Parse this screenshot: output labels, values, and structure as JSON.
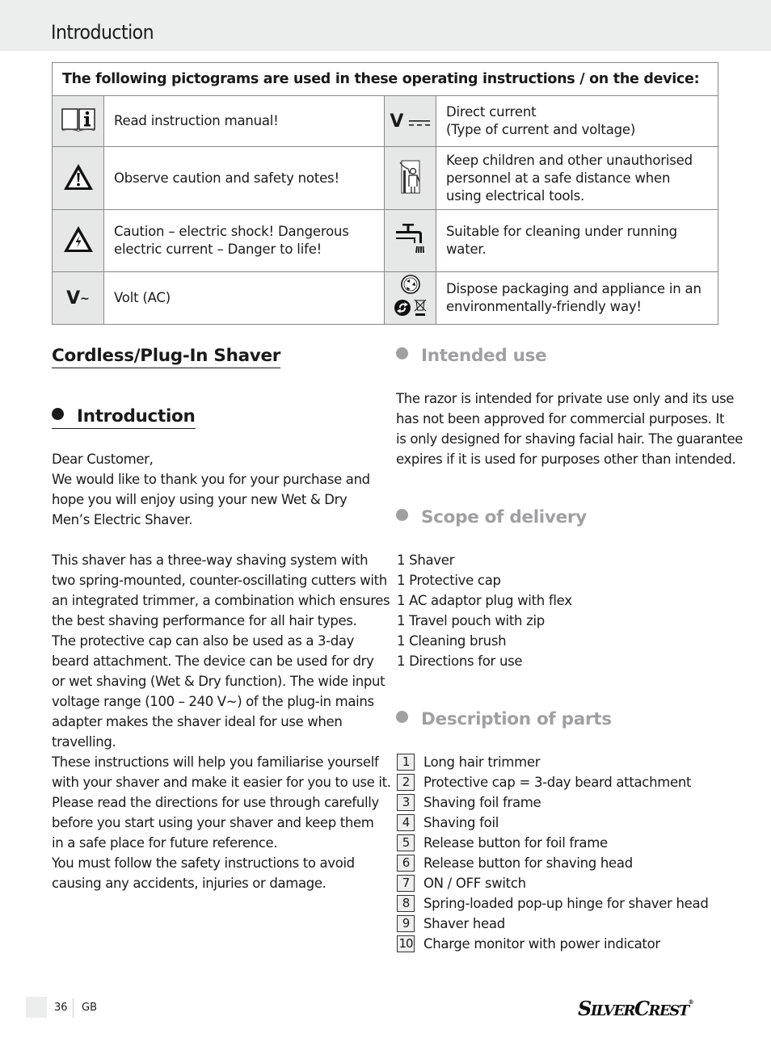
{
  "header": {
    "title": "Introduction"
  },
  "pictogram_table": {
    "heading": "The following pictograms are used in these operating instructions / on the device:",
    "rows": [
      {
        "left": {
          "icon": "book-info-icon",
          "text": "Read instruction manual!"
        },
        "right": {
          "icon": "direct-current-icon",
          "icon_label": "V",
          "text_line1": "Direct current",
          "text_line2": "(Type of current and voltage)"
        }
      },
      {
        "left": {
          "icon": "warning-triangle-icon",
          "text": "Observe caution and safety notes!"
        },
        "right": {
          "icon": "keep-children-away-icon",
          "text": "Keep children and other unauthorised personnel at a safe distance when using electrical tools."
        }
      },
      {
        "left": {
          "icon": "electric-shock-icon",
          "text": "Caution – electric shock! Dangerous electric current – Danger to life!"
        },
        "right": {
          "icon": "running-water-tap-icon",
          "text": "Suitable for cleaning under running water."
        }
      },
      {
        "left": {
          "icon": "volt-ac-icon",
          "icon_label": "V",
          "icon_suffix": "~",
          "text": "Volt (AC)"
        },
        "right": {
          "icon": "recycling-disposal-icon",
          "text": "Dispose packaging and appliance in an environmentally-friendly way!"
        }
      }
    ]
  },
  "left_column": {
    "product_title": "Cordless/Plug-In Shaver",
    "intro_heading": "Introduction",
    "paragraphs": [
      [
        "Dear Customer,",
        "We would like to thank you for your purchase and",
        "hope you will enjoy using your new Wet & Dry",
        "Men’s Electric Shaver."
      ],
      [
        "This shaver has a three-way shaving system with",
        "two spring-mounted, counter-oscillating cutters with",
        "an integrated trimmer, a combination which ensures",
        "the best shaving performance for all hair types.",
        "The protective cap can also be used as a 3-day",
        "beard attachment. The device can be used for dry",
        "or wet shaving (Wet & Dry function). The wide input",
        "voltage range (100 – 240 V~) of the plug-in mains",
        "adapter makes the shaver ideal for use when",
        "travelling.",
        "These instructions will help you familiarise yourself",
        "with your shaver and make it easier for you to use it.",
        "Please read the directions for use through carefully",
        "before you start using your shaver and keep them",
        "in a safe place for future reference.",
        "You must follow the safety instructions to avoid",
        "causing any accidents, injuries or damage."
      ]
    ]
  },
  "right_column": {
    "intended_use": {
      "heading": "Intended use",
      "lines": [
        "The razor is intended for private use only and its use",
        "has not been approved for commercial purposes. It",
        "is only designed for shaving facial hair. The guarantee",
        "expires if it is used for purposes other than intended."
      ]
    },
    "scope_of_delivery": {
      "heading": "Scope of delivery",
      "items": [
        "1 Shaver",
        "1 Protective cap",
        "1 AC adaptor plug with flex",
        "1 Travel pouch with zip",
        "1 Cleaning brush",
        "1 Directions for use"
      ]
    },
    "description_of_parts": {
      "heading": "Description of parts",
      "items": [
        {
          "num": "1",
          "label": "Long hair trimmer"
        },
        {
          "num": "2",
          "label": "Protective cap = 3-day beard attachment"
        },
        {
          "num": "3",
          "label": "Shaving foil frame"
        },
        {
          "num": "4",
          "label": "Shaving foil"
        },
        {
          "num": "5",
          "label": "Release button for foil frame"
        },
        {
          "num": "6",
          "label": "Release button for shaving head"
        },
        {
          "num": "7",
          "label": "ON / OFF switch"
        },
        {
          "num": "8",
          "label": "Spring-loaded pop-up hinge for shaver head"
        },
        {
          "num": "9",
          "label": "Shaver head"
        },
        {
          "num": "10",
          "label": "Charge monitor with power indicator"
        }
      ]
    }
  },
  "footer": {
    "page_number": "36",
    "language": "GB",
    "brand_part1_cap": "S",
    "brand_part1_rest": "ILVER",
    "brand_part2_cap": "C",
    "brand_part2_rest": "REST",
    "brand_mark": "®"
  },
  "colors": {
    "header_band": "#eceeed",
    "icon_cell": "#e6e7e7",
    "grey_heading": "#a0a0a2"
  }
}
